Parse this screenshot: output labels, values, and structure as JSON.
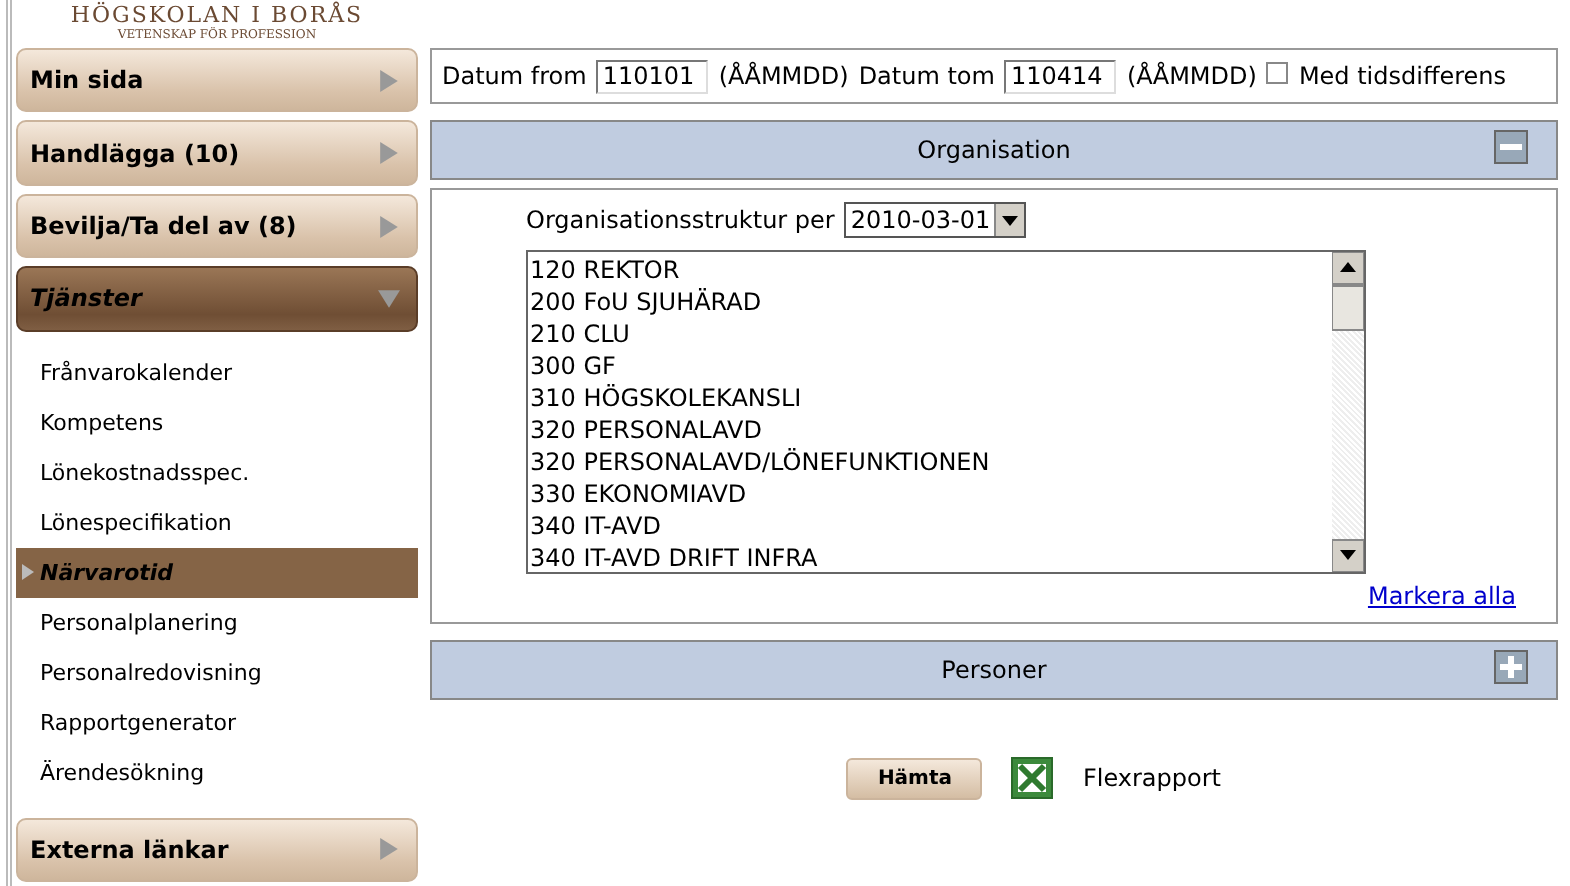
{
  "logo": {
    "name": "HÖGSKOLAN I BORÅS",
    "tagline": "VETENSKAP FÖR PROFESSION"
  },
  "sidebar": {
    "sections": [
      {
        "label": "Min sida",
        "expanded": false
      },
      {
        "label": "Handlägga (10)",
        "expanded": false
      },
      {
        "label": "Bevilja/Ta del av (8)",
        "expanded": false
      },
      {
        "label": "Tjänster",
        "expanded": true,
        "items": [
          {
            "label": "Frånvarokalender",
            "selected": false
          },
          {
            "label": "Kompetens",
            "selected": false
          },
          {
            "label": "Lönekostnadsspec.",
            "selected": false
          },
          {
            "label": "Lönespecifikation",
            "selected": false
          },
          {
            "label": "Närvarotid",
            "selected": true
          },
          {
            "label": "Personalplanering",
            "selected": false
          },
          {
            "label": "Personalredovisning",
            "selected": false
          },
          {
            "label": "Rapportgenerator",
            "selected": false
          },
          {
            "label": "Ärendesökning",
            "selected": false
          }
        ]
      },
      {
        "label": "Externa länkar",
        "expanded": false
      }
    ]
  },
  "date_bar": {
    "from_label": "Datum from",
    "from_value": "110101",
    "from_format": "(ÅÅMMDD)",
    "to_label": "Datum tom",
    "to_value": "110414",
    "to_format": "(ÅÅMMDD)",
    "checkbox_label": "Med tidsdifferens",
    "checked": false
  },
  "organisation": {
    "title": "Organisation",
    "expanded": true,
    "structure_label": "Organisationsstruktur per",
    "structure_value": "2010-03-01",
    "units": [
      "120 REKTOR",
      "200 FoU SJUHÄRAD",
      "210 CLU",
      "300 GF",
      "310 HÖGSKOLEKANSLI",
      "320 PERSONALAVD",
      "320 PERSONALAVD/LÖNEFUNKTIONEN",
      "330 EKONOMIAVD",
      "340 IT-AVD",
      "340 IT-AVD DRIFT INFRA"
    ],
    "select_all": "Markera alla"
  },
  "personer": {
    "title": "Personer",
    "expanded": false
  },
  "actions": {
    "fetch_button": "Hämta",
    "report_label": "Flexrapport"
  }
}
